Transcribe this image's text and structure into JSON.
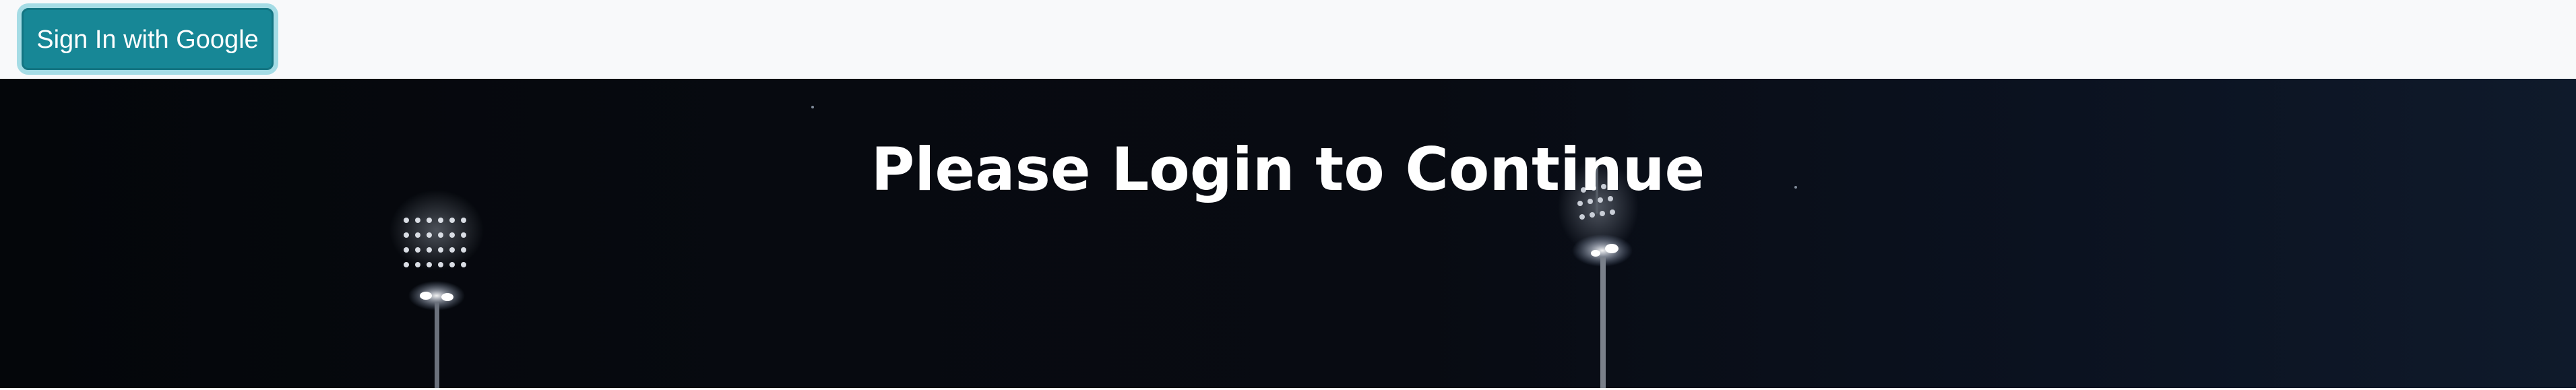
{
  "navbar": {
    "login_button_label": "Sign In with Google"
  },
  "hero": {
    "title": "Please Login to Continue",
    "background_image": "night-stadium-floodlights"
  },
  "colors": {
    "navbar_bg": "#f8f9fa",
    "button_bg": "#178796",
    "button_text": "#ffffff",
    "hero_bg": "#05070b",
    "title_text": "#ffffff"
  }
}
